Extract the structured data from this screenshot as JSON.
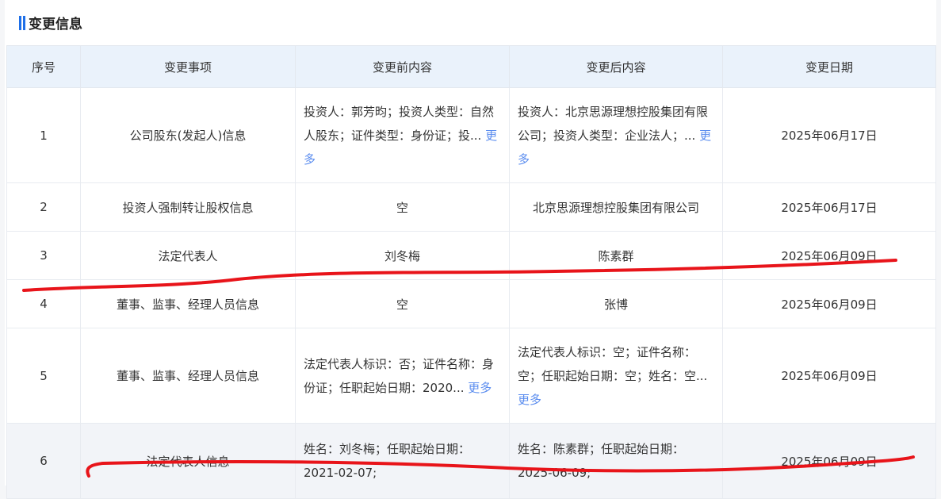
{
  "section": {
    "title": "变更信息"
  },
  "table": {
    "headers": [
      "序号",
      "变更事项",
      "变更前内容",
      "变更后内容",
      "变更日期"
    ],
    "rows": [
      {
        "no": "1",
        "item": "公司股东(发起人)信息",
        "before": "投资人：郭芳昀；投资人类型：自然人股东；证件类型：身份证；投...",
        "before_more": "更多",
        "after": "投资人：北京思源理想控股集团有限公司；投资人类型：企业法人；...",
        "after_more": "更多",
        "date": "2025年06月17日"
      },
      {
        "no": "2",
        "item": "投资人强制转让股权信息",
        "before": "空",
        "after": "北京思源理想控股集团有限公司",
        "date": "2025年06月17日"
      },
      {
        "no": "3",
        "item": "法定代表人",
        "before": "刘冬梅",
        "after": "陈素群",
        "date": "2025年06月09日"
      },
      {
        "no": "4",
        "item": "董事、监事、经理人员信息",
        "before": "空",
        "after": "张博",
        "date": "2025年06月09日"
      },
      {
        "no": "5",
        "item": "董事、监事、经理人员信息",
        "before": "法定代表人标识：否；证件名称：身份证；任职起始日期：2020...",
        "before_more": "更多",
        "after": "法定代表人标识：空；证件名称：空；任职起始日期：空；姓名：空...",
        "after_more": "更多",
        "date": "2025年06月09日"
      },
      {
        "no": "6",
        "item": "法定代表人信息",
        "before": "姓名：刘冬梅；任职起始日期：2021-02-07;",
        "after": "姓名：陈素群；任职起始日期：2025-06-09;",
        "date": "2025年06月09日"
      }
    ]
  },
  "colors": {
    "accent": "#1e6fe8",
    "header_bg": "#eaf2fb",
    "link": "#5b8def",
    "annotation": "#e8141a"
  }
}
